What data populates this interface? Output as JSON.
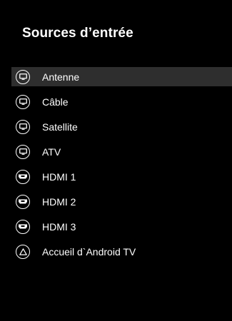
{
  "panel": {
    "title": "Sources d’entrée"
  },
  "sources": [
    {
      "label": "Antenne",
      "icon": "tv-icon",
      "selected": true
    },
    {
      "label": "Câble",
      "icon": "tv-icon",
      "selected": false
    },
    {
      "label": "Satellite",
      "icon": "tv-icon",
      "selected": false
    },
    {
      "label": "ATV",
      "icon": "tv-icon",
      "selected": false
    },
    {
      "label": "HDMI 1",
      "icon": "hdmi-icon",
      "selected": false
    },
    {
      "label": "HDMI 2",
      "icon": "hdmi-icon",
      "selected": false
    },
    {
      "label": "HDMI 3",
      "icon": "hdmi-icon",
      "selected": false
    },
    {
      "label": "Accueil d`Android TV",
      "icon": "home-triangle-icon",
      "selected": false
    }
  ],
  "colors": {
    "background": "#000000",
    "text": "#ffffff",
    "selected_row": "#2e2e2e"
  }
}
